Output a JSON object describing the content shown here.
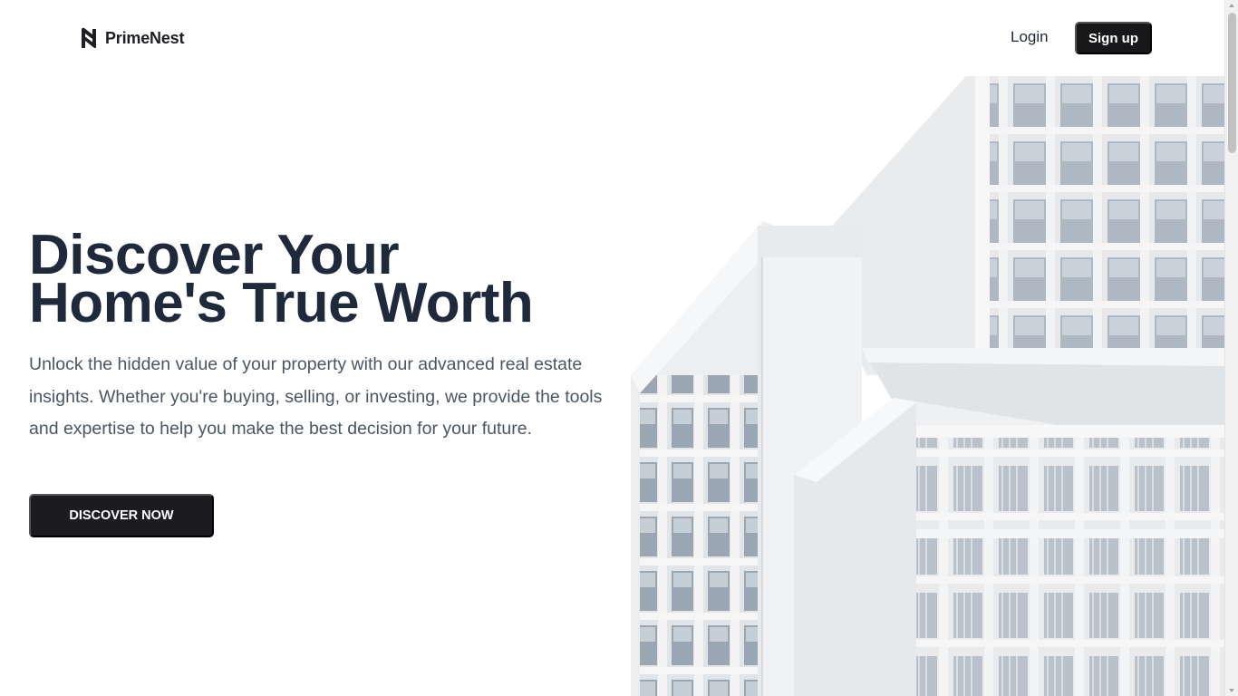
{
  "brand": {
    "name": "PrimeNest",
    "icon": "primenest-logo-icon"
  },
  "nav": {
    "login_label": "Login",
    "signup_label": "Sign up"
  },
  "hero": {
    "title_line1": "Discover Your",
    "title_line2": "Home's True Worth",
    "description": "Unlock the hidden value of your property with our advanced real estate insights. Whether you're buying, selling, or investing, we provide the tools and expertise to help you make the best decision for your future.",
    "cta_label": "DISCOVER NOW",
    "image": "modern-white-apartment-building-photo"
  },
  "colors": {
    "primary_dark": "#18181b",
    "heading": "#1e293b",
    "body_text": "#4b5563",
    "background": "#ffffff"
  }
}
